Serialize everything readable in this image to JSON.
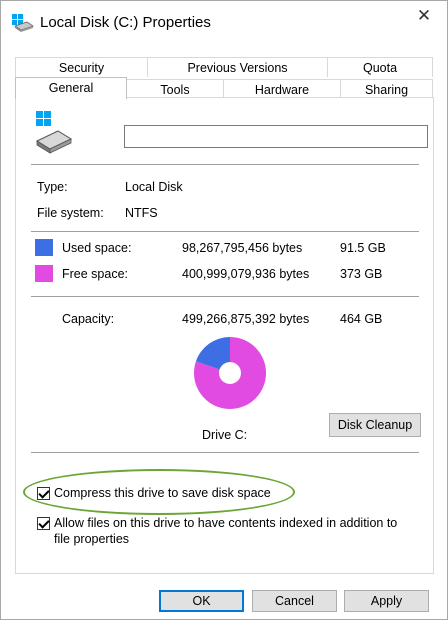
{
  "window": {
    "title": "Local Disk (C:) Properties",
    "close_glyph": "✕"
  },
  "tabs": {
    "row1": [
      "Security",
      "Previous Versions",
      "Quota"
    ],
    "row2": [
      "General",
      "Tools",
      "Hardware",
      "Sharing"
    ],
    "active": "General"
  },
  "general": {
    "volume_label": "",
    "type_label": "Type:",
    "type_value": "Local Disk",
    "fs_label": "File system:",
    "fs_value": "NTFS",
    "used": {
      "label": "Used space:",
      "bytes": "98,267,795,456 bytes",
      "size": "91.5 GB",
      "color": "#3d6ee3"
    },
    "free": {
      "label": "Free space:",
      "bytes": "400,999,079,936 bytes",
      "size": "373 GB",
      "color": "#e24be2"
    },
    "capacity": {
      "label": "Capacity:",
      "bytes": "499,266,875,392 bytes",
      "size": "464 GB"
    },
    "drive_label": "Drive C:",
    "disk_cleanup": "Disk Cleanup",
    "used_fraction": 0.197
  },
  "options": {
    "compress": {
      "label": "Compress this drive to save disk space",
      "checked": true
    },
    "index": {
      "label_line1": "Allow files on this drive to have contents indexed in addition to",
      "label_line2": "file properties",
      "checked": true
    }
  },
  "buttons": {
    "ok": "OK",
    "cancel": "Cancel",
    "apply": "Apply"
  }
}
